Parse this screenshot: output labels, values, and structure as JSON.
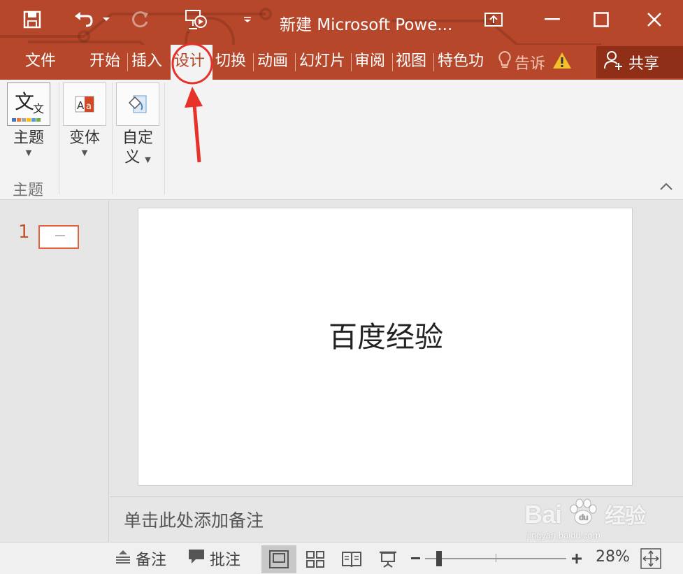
{
  "window": {
    "title": "新建 Microsoft Powe..."
  },
  "tabs": [
    {
      "label": "文件",
      "active": false
    },
    {
      "label": "开始",
      "active": false
    },
    {
      "label": "插入",
      "active": false
    },
    {
      "label": "设计",
      "active": true
    },
    {
      "label": "切换",
      "active": false
    },
    {
      "label": "动画",
      "active": false
    },
    {
      "label": "幻灯片",
      "active": false
    },
    {
      "label": "审阅",
      "active": false
    },
    {
      "label": "视图",
      "active": false
    },
    {
      "label": "特色功",
      "active": false
    }
  ],
  "tell_me": {
    "label": "告诉"
  },
  "share": {
    "label": "共享"
  },
  "ribbon": {
    "buttons": [
      {
        "label": "主题",
        "icon": "themes-icon"
      },
      {
        "label": "变体",
        "icon": "variants-icon"
      },
      {
        "label": "自定义",
        "label_line1": "自定",
        "label_line2": "义",
        "icon": "customize-icon"
      }
    ],
    "group_label": "主题"
  },
  "thumbnails": [
    {
      "number": "1"
    }
  ],
  "slide": {
    "title": "百度经验"
  },
  "notes": {
    "placeholder": "单击此处添加备注"
  },
  "statusbar": {
    "notes_label": "备注",
    "comments_label": "批注",
    "zoom_percent": "28%",
    "zoom_level": 0.28
  },
  "watermark": {
    "brand": "Bai",
    "brand_product": "经验",
    "url": "jingyan.baidu.com"
  },
  "colors": {
    "accent": "#b7472a",
    "annotation": "#e8312a"
  }
}
